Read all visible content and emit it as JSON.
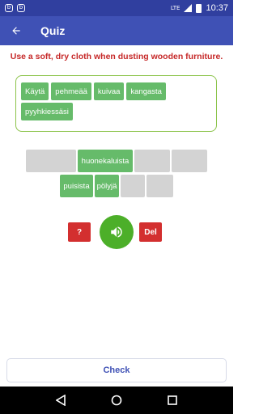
{
  "status_bar": {
    "notification_icons": [
      "b",
      "b"
    ],
    "network": "LTE",
    "time": "10:37"
  },
  "app_bar": {
    "title": "Quiz",
    "back_icon": "arrow-back-icon"
  },
  "sentence": "Use a soft, dry cloth when dusting wooden furniture.",
  "answer_words": [
    "Käytä",
    "pehmeää",
    "kuivaa",
    "kangasta",
    "pyyhkiessäsi"
  ],
  "word_bank": {
    "row1": [
      "",
      "huonekaluista",
      "",
      ""
    ],
    "row2": [
      "puisista",
      "pölyjä",
      "",
      ""
    ]
  },
  "controls": {
    "hint_label": "?",
    "speak_icon": "speaker-icon",
    "delete_label": "Del"
  },
  "check_label": "Check",
  "colors": {
    "primary": "#3f51b5",
    "status": "#303f9f",
    "chip_green": "#66bb6a",
    "sentence_red": "#c62828",
    "button_red": "#d32f2f",
    "speak_green": "#4caf29"
  }
}
